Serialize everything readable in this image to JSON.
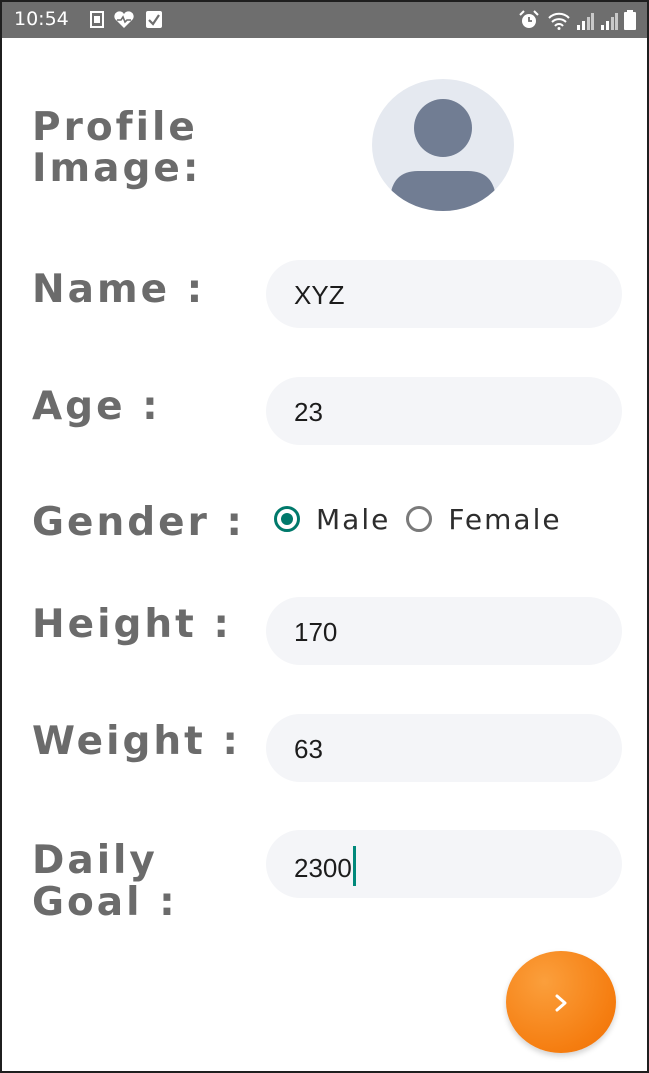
{
  "status_bar": {
    "time": "10:54",
    "left_icons": [
      "sim-card-icon",
      "heart-icon",
      "checkbox-icon"
    ],
    "right_icons": [
      "alarm-icon",
      "wifi-icon",
      "signal-icon",
      "signal-icon",
      "battery-icon"
    ]
  },
  "form": {
    "profile_image_label": "Profile\nImage:",
    "name_label": "Name :",
    "name_value": "XYZ",
    "age_label": "Age :",
    "age_value": "23",
    "gender_label": "Gender :",
    "gender_options": [
      "Male",
      "Female"
    ],
    "gender_selected": "Male",
    "height_label": "Height :",
    "height_value": "170",
    "weight_label": "Weight :",
    "weight_value": "63",
    "daily_goal_label": "Daily\nGoal :",
    "daily_goal_value": "2300"
  },
  "colors": {
    "accent": "#00796b",
    "next_button": "#f57d10",
    "field_background": "#f4f5f8",
    "label_text": "#6b6b6b",
    "status_bar": "#6e6e6e"
  },
  "next_button": {
    "icon": "chevron-right-icon"
  }
}
